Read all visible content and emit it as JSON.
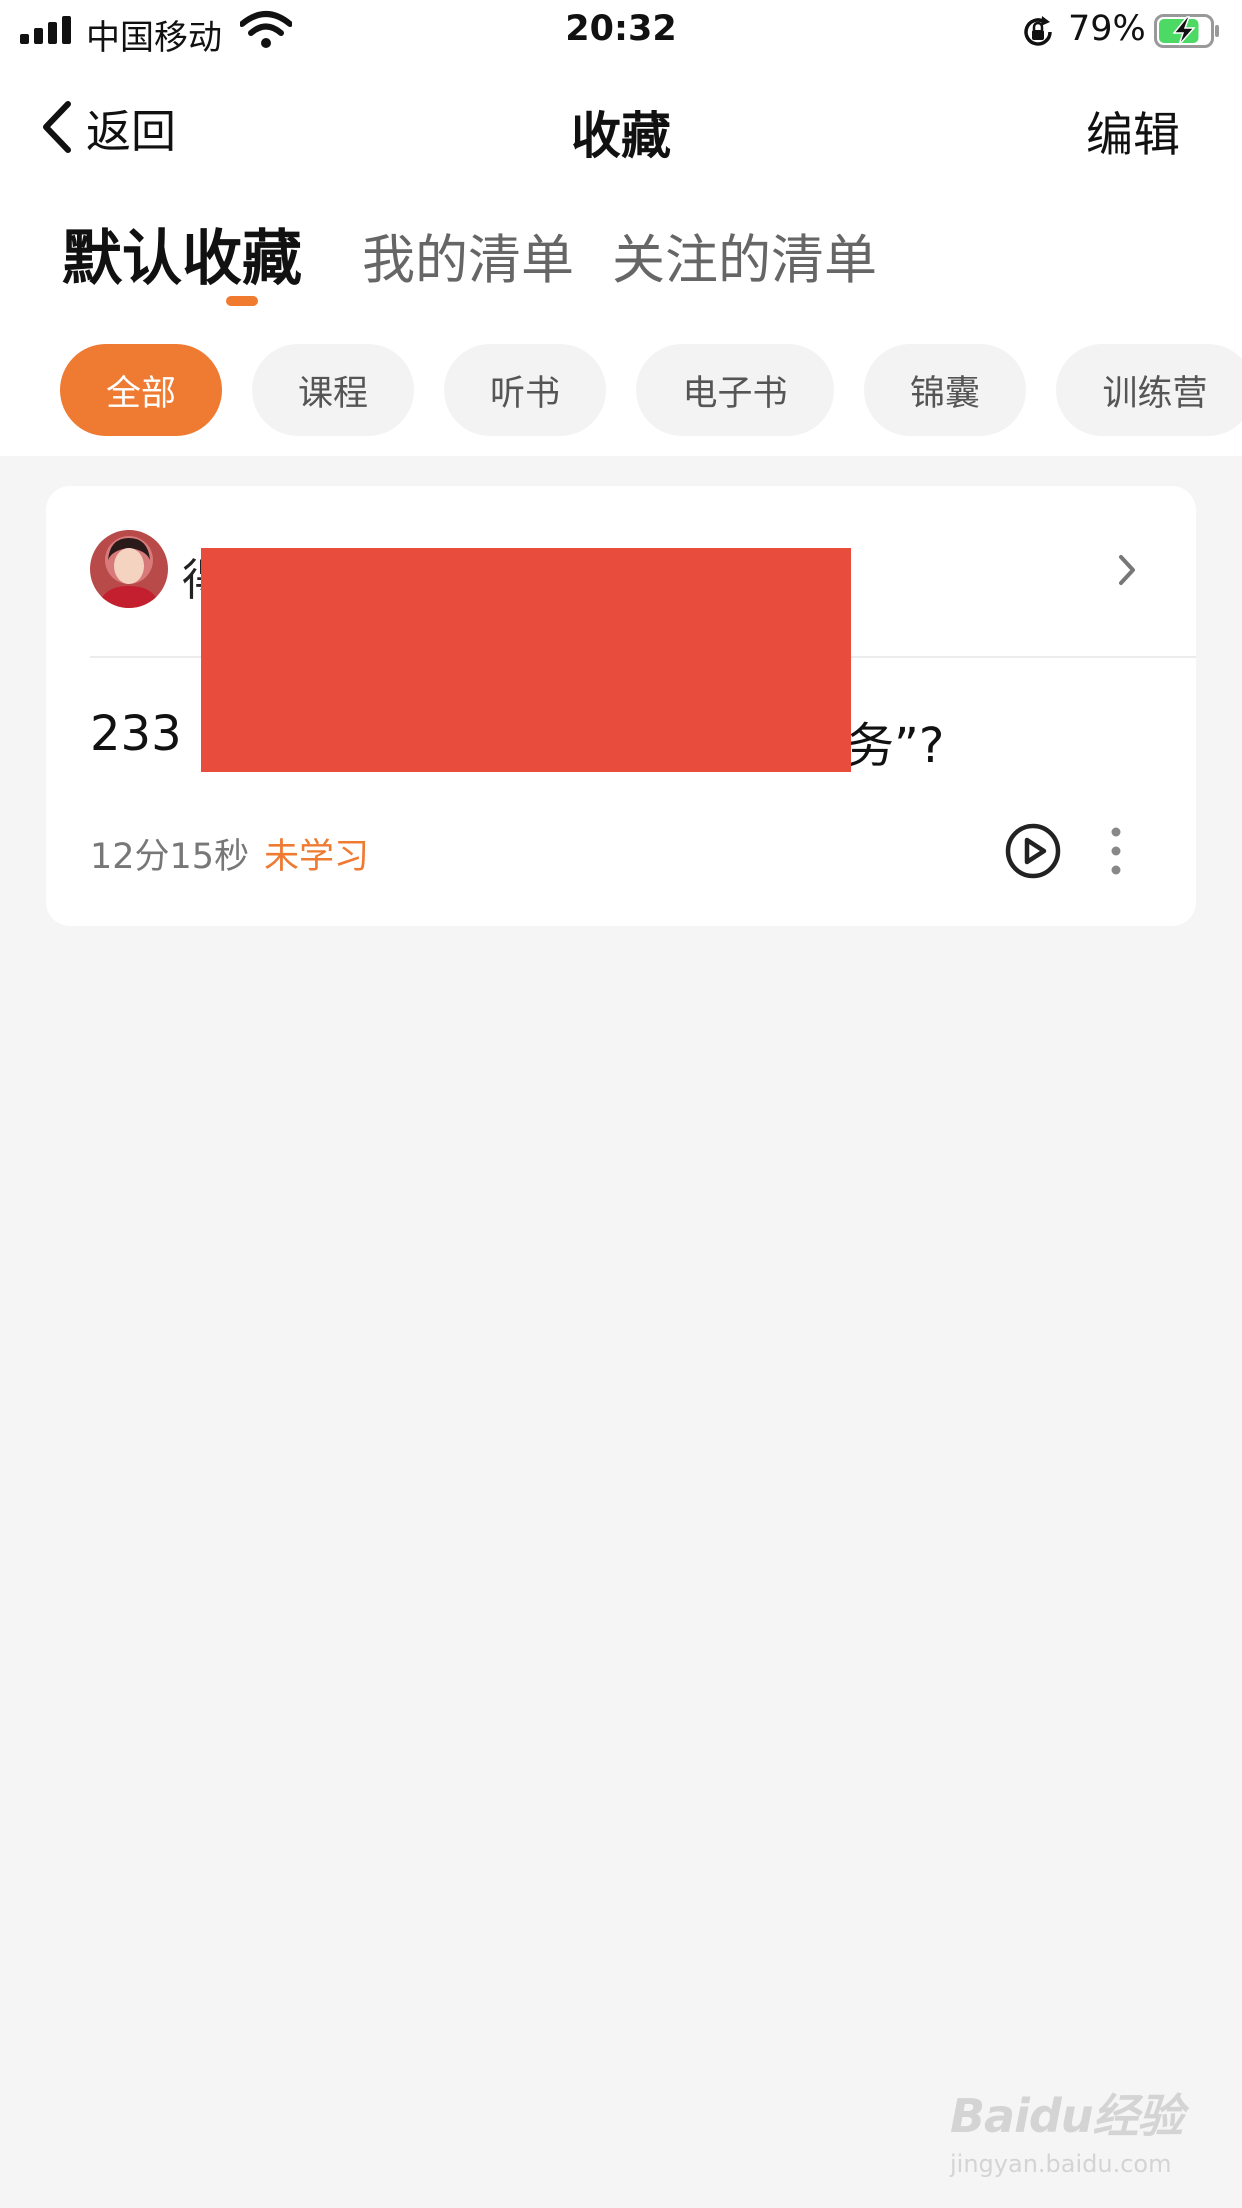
{
  "status_bar": {
    "carrier": "中国移动",
    "time": "20:32",
    "battery_percent": "79%",
    "battery_level": 0.79,
    "charging": true
  },
  "nav": {
    "back_label": "返回",
    "title": "收藏",
    "edit_label": "编辑"
  },
  "tabs": [
    {
      "label": "默认收藏",
      "active": true
    },
    {
      "label": "我的清单",
      "active": false
    },
    {
      "label": "关注的清单",
      "active": false
    }
  ],
  "filters": [
    {
      "label": "全部",
      "active": true
    },
    {
      "label": "课程",
      "active": false
    },
    {
      "label": "听书",
      "active": false
    },
    {
      "label": "电子书",
      "active": false
    },
    {
      "label": "锦囊",
      "active": false
    },
    {
      "label": "训练营",
      "active": false
    }
  ],
  "card": {
    "author_visible": "得",
    "title_start": "233 |",
    "title_end": "务”?",
    "duration": "12分15秒",
    "status": "未学习"
  },
  "watermark": {
    "brand": "Baidu经验",
    "url": "jingyan.baidu.com"
  },
  "colors": {
    "accent": "#ef7a32",
    "redaction": "#e84c3d",
    "background": "#f5f5f5"
  },
  "icons": [
    "signal-icon",
    "wifi-icon",
    "rotation-lock-icon",
    "battery-icon",
    "back-chevron-icon",
    "chevron-right-icon",
    "play-icon",
    "more-vertical-icon"
  ]
}
